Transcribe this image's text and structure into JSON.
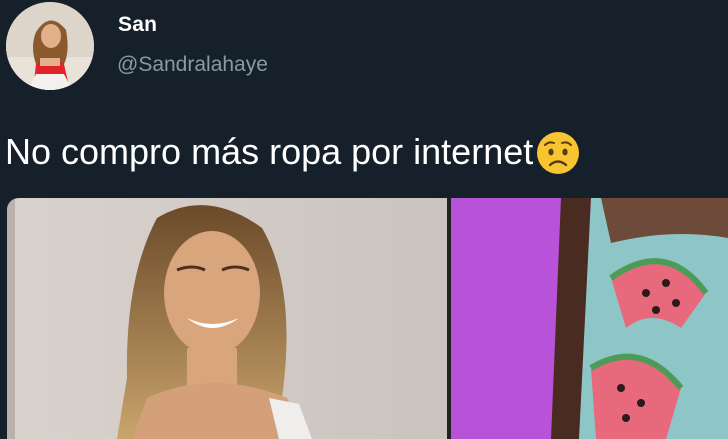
{
  "tweet": {
    "display_name": "San",
    "handle": "@Sandralahaye",
    "text": "No compro más ropa por internet",
    "emoji": "worried-face-emoji"
  },
  "colors": {
    "background": "#15202b",
    "text_primary": "#ffffff",
    "text_secondary": "#8b98a5",
    "emoji_yellow": "#f7c531"
  },
  "media": {
    "count": 2,
    "items": [
      "photo-woman-smiling",
      "photo-watermelon-print-garment"
    ]
  }
}
